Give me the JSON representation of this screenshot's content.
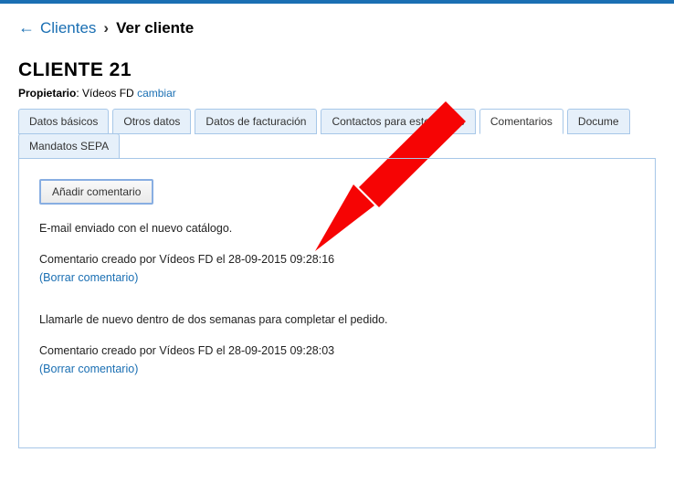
{
  "breadcrumb": {
    "back_target": "Clientes",
    "current": "Ver cliente"
  },
  "page": {
    "title": "CLIENTE 21",
    "owner_label": "Propietario",
    "owner_name": "Vídeos FD",
    "change_label": "cambiar"
  },
  "tabs": {
    "row1": [
      {
        "label": "Datos básicos"
      },
      {
        "label": "Otros datos"
      },
      {
        "label": "Datos de facturación"
      },
      {
        "label": "Contactos para este cliente"
      },
      {
        "label": "Comentarios",
        "active": true
      },
      {
        "label": "Docume"
      }
    ],
    "row2": [
      {
        "label": "Mandatos SEPA"
      }
    ]
  },
  "panel": {
    "add_button": "Añadir comentario",
    "comments": [
      {
        "text": "E-mail enviado con el nuevo catálogo.",
        "meta": "Comentario creado por Vídeos FD el 28-09-2015 09:28:16",
        "delete": "(Borrar comentario)"
      },
      {
        "text": "Llamarle de nuevo dentro de dos semanas para completar el pedido.",
        "meta": "Comentario creado por Vídeos FD el 28-09-2015 09:28:03",
        "delete": "(Borrar comentario)"
      }
    ]
  }
}
